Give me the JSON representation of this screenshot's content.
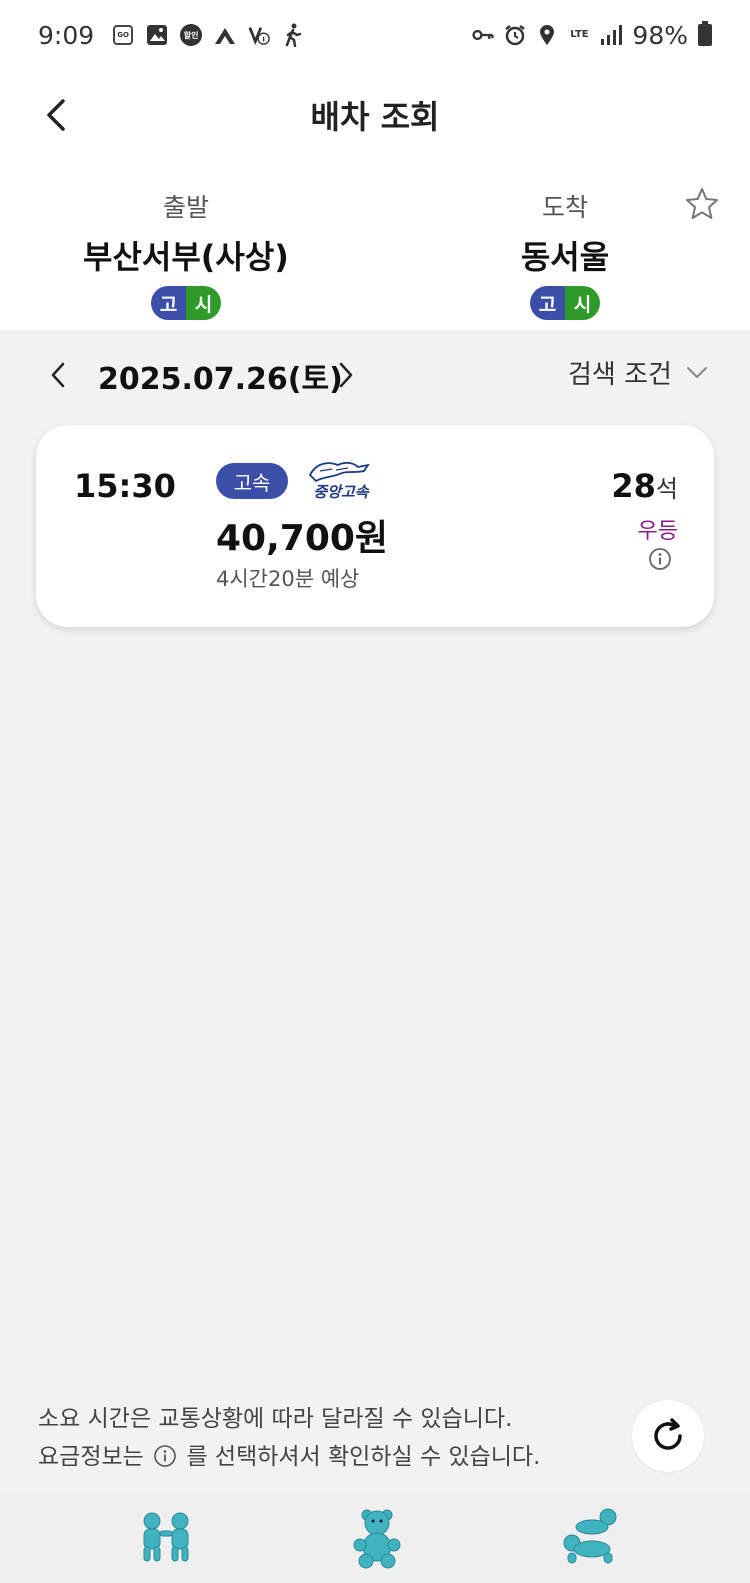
{
  "status_bar": {
    "time": "9:09",
    "battery": "98%",
    "network": "LTE",
    "left_icons": [
      "go-app-icon",
      "gallery-icon",
      "discount-icon",
      "navigation-icon",
      "vpn-info-icon",
      "walking-icon"
    ],
    "right_icons": [
      "key-icon",
      "alarm-icon",
      "location-icon",
      "lte-icon",
      "signal-icon",
      "battery-icon"
    ],
    "discount_label": "할인",
    "go_label": "GO"
  },
  "header": {
    "title": "배차 조회",
    "departure": {
      "label": "출발",
      "name": "부산서부(사상)",
      "badge_go": "고",
      "badge_si": "시"
    },
    "arrival": {
      "label": "도착",
      "name": "동서울",
      "badge_go": "고",
      "badge_si": "시"
    }
  },
  "date_bar": {
    "date": "2025.07.26(토)",
    "search_condition": "검색 조건"
  },
  "bus_list": [
    {
      "departure_time": "15:30",
      "grade": "고속",
      "company": "중앙고속",
      "fare": "40,700원",
      "duration": "4시간20분 예상",
      "seats": "28",
      "seats_unit": "석",
      "bus_class": "우등"
    }
  ],
  "notice": {
    "line1": "소요 시간은 교통상황에 따라 달라질 수 있습니다.",
    "line2_before": "요금정보는",
    "line2_after": "를 선택하셔서 확인하실 수 있습니다."
  },
  "bottom_nav": [
    "friends-doll-icon",
    "teddy-bear-icon",
    "crawling-dolls-icon"
  ],
  "colors": {
    "accent_blue": "#3b4fa8",
    "badge_green": "#2f9a2a",
    "class_purple": "#8a1b8a",
    "doll_teal": "#3fb3c0"
  }
}
